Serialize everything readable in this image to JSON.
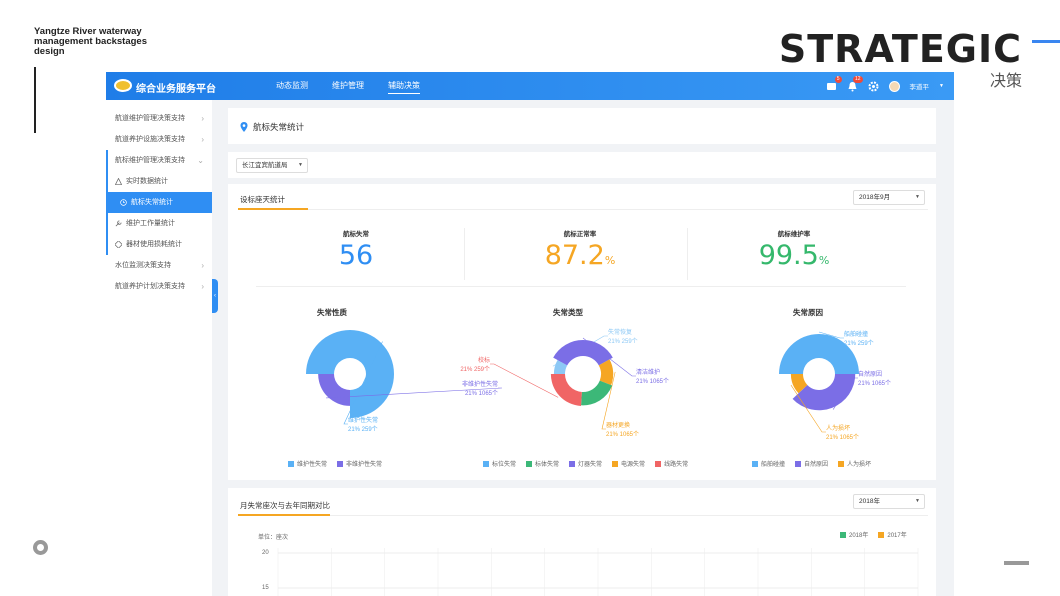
{
  "slide": {
    "caption": "Yangtze River waterway management backstages design",
    "brand": "STRATEGIC",
    "brand_sub": "决策"
  },
  "app": {
    "title": "综合业务服务平台",
    "nav": [
      "动态监测",
      "维护管理",
      "辅助决策"
    ],
    "active_nav": "辅助决策",
    "badges": [
      "5",
      "12"
    ],
    "user_name": "李道平"
  },
  "sidebar": {
    "items": [
      {
        "label": "航道维护管理决策支持"
      },
      {
        "label": "航道养护设施决策支持"
      },
      {
        "label": "航标维护管理决策支持"
      },
      {
        "label": "实时数据统计"
      },
      {
        "label": "航标失常统计"
      },
      {
        "label": "维护工作量统计"
      },
      {
        "label": "器材使用损耗统计"
      },
      {
        "label": "水位监测决策支持"
      },
      {
        "label": "航道养护计划决策支持"
      }
    ]
  },
  "header": {
    "title": "航标失常统计"
  },
  "filter": {
    "bureau": "长江宜宾航道局"
  },
  "stats_section": {
    "title": "设标座天统计",
    "month": "2018年9月",
    "stats": [
      {
        "label": "航标失常",
        "value": "56",
        "suffix": ""
      },
      {
        "label": "航标正常率",
        "value": "87.2",
        "suffix": "%"
      },
      {
        "label": "航标维护率",
        "value": "99.5",
        "suffix": "%"
      }
    ]
  },
  "colors": {
    "blue": "#2f8ef3",
    "orange": "#f5a623",
    "green": "#35b86c",
    "light_blue": "#5ab1f5",
    "purple": "#7b6ee6",
    "red": "#f06565",
    "emerald": "#3cb878"
  },
  "chart_data": [
    {
      "type": "pie",
      "title": "失常性质",
      "slices": [
        {
          "name": "维护性失常",
          "percent": "21%",
          "count": "259个",
          "value": 75,
          "color": "#5ab1f5"
        },
        {
          "name": "非维护性失常",
          "percent": "21%",
          "count": "1065个",
          "value": 25,
          "color": "#7b6ee6"
        }
      ],
      "legend": [
        "维护性失常",
        "非维护性失常"
      ]
    },
    {
      "type": "pie",
      "title": "失常类型",
      "slices": [
        {
          "name": "失常恢复",
          "percent": "21%",
          "count": "259个",
          "value": 8,
          "color": "#8cc8f5"
        },
        {
          "name": "清洁维护",
          "percent": "21%",
          "count": "1065个",
          "value": 34,
          "color": "#7b6ee6"
        },
        {
          "name": "器材更换",
          "percent": "21%",
          "count": "1065个",
          "value": 14,
          "color": "#f5a623"
        },
        {
          "name": "",
          "percent": "",
          "count": "",
          "value": 20,
          "color": "#3cb878"
        },
        {
          "name": "校标",
          "percent": "21%",
          "count": "259个",
          "value": 24,
          "color": "#f06565"
        }
      ],
      "legend": [
        "标位失常",
        "标体失常",
        "灯器失常",
        "电源失常",
        "线路失常"
      ],
      "legend_colors": [
        "#5ab1f5",
        "#3cb878",
        "#7b6ee6",
        "#f5a623",
        "#f06565"
      ]
    },
    {
      "type": "pie",
      "title": "失常原因",
      "slices": [
        {
          "name": "船舶碰撞",
          "percent": "21%",
          "count": "259个",
          "value": 50,
          "color": "#5ab1f5"
        },
        {
          "name": "自然原因",
          "percent": "21%",
          "count": "1065个",
          "value": 38,
          "color": "#7b6ee6"
        },
        {
          "name": "人为损坏",
          "percent": "21%",
          "count": "1065个",
          "value": 12,
          "color": "#f5a623"
        }
      ],
      "legend": [
        "船舶碰撞",
        "自然原因",
        "人为损坏"
      ]
    },
    {
      "type": "line",
      "title": "月失常座次与去年同期对比",
      "year_select": "2018年",
      "unit_label": "单位：座次",
      "series": [
        {
          "name": "2018年",
          "color": "#3cb878"
        },
        {
          "name": "2017年",
          "color": "#f5a623"
        }
      ],
      "yticks": [
        "20",
        "15"
      ]
    }
  ]
}
